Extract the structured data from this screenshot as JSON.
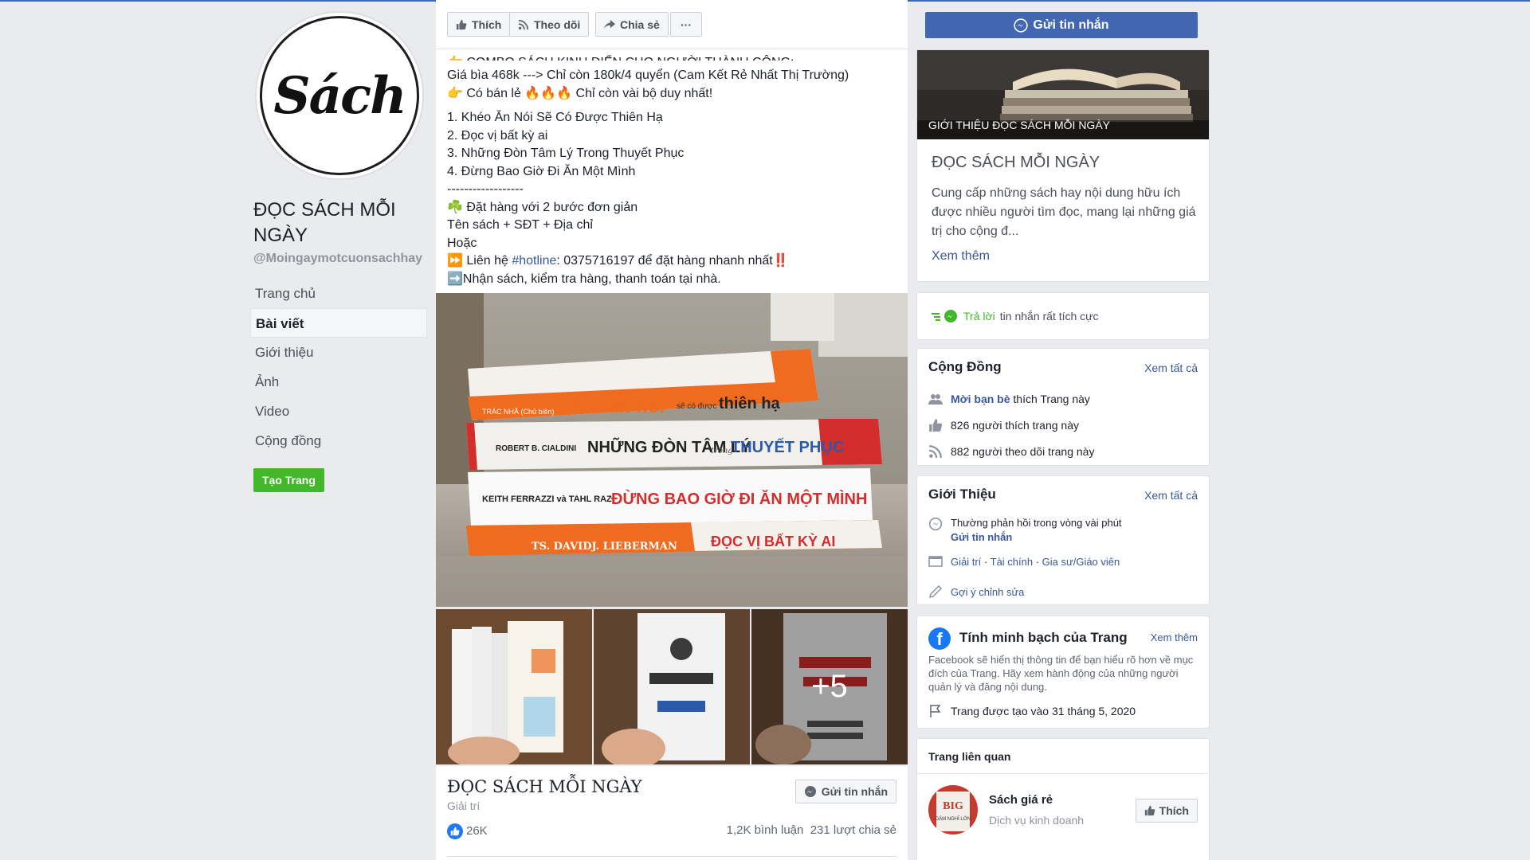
{
  "page": {
    "avatar_text": "Sách",
    "name": "ĐỌC SÁCH MỖI NGÀY",
    "handle": "@Moingaymotcuonsachhay",
    "nav": [
      "Trang chủ",
      "Bài viết",
      "Giới thiệu",
      "Ảnh",
      "Video",
      "Cộng đồng"
    ],
    "create_page": "Tạo Trang"
  },
  "actions": {
    "like": "Thích",
    "follow": "Theo dõi",
    "share": "Chia sẻ",
    "more": "···",
    "send_message": "Gửi tin nhắn"
  },
  "post": {
    "cut_line": "👉 COMBO SÁCH KINH ĐIỂN CHO NGƯỜI THÀNH CÔNG:",
    "price_line": "Giá bìa 468k ---> Chỉ còn 180k/4 quyển (Cam Kết Rẻ Nhất Thị Trường)",
    "retail_line": "👉 Có bán lẻ 🔥🔥🔥 Chỉ còn vài bộ duy nhất!",
    "books": [
      "1. Khéo Ăn Nói Sẽ Có Được Thiên Hạ",
      "2. Đọc vị bất kỳ ai",
      "3. Những Đòn Tâm Lý Trong Thuyết Phục",
      "4. Đừng Bao Giờ Đi Ăn Một Mình"
    ],
    "separator": "------------------",
    "order_line": "☘️ Đặt hàng với 2 bước đơn giản",
    "order_format": "Tên sách + SĐT + Địa chỉ",
    "or": "Hoặc",
    "contact_prefix": "⏩ Liên hệ ",
    "contact_tag": "#hotline",
    "contact_suffix": ": 0375716197 để đặt hàng nhanh nhất‼️",
    "receive_line": "➡️Nhận sách, kiểm tra hàng, thanh toán tại nhà.",
    "photo_more": "+5",
    "footer": {
      "title": "ĐỌC SÁCH MỖI NGÀY",
      "category": "Giải trí",
      "message_btn": "Gửi tin nhắn",
      "likes": "26K",
      "comments": "1,2K bình luận",
      "shares": "231 lượt chia sẻ"
    },
    "book_spines": {
      "b1_author": "TRÁC NHÃ (Chủ biên)",
      "b1_title": "Khéo ăn nói",
      "b1_sub": "sẽ có được",
      "b1_end": "thiên hạ",
      "b2_author": "ROBERT B. CIALDINI",
      "b2_title": "NHỮNG ĐÒN TÂM LÝ",
      "b2_sub": "trong",
      "b2_end": "THUYẾT PHỤC",
      "b3_author": "KEITH FERRAZZI và TAHL RAZ",
      "b3_title": "ĐỪNG BAO GIỜ ĐI ĂN MỘT MÌNH",
      "b4_author": "TS. DAVIDJ. LIEBERMAN",
      "b4_title": "ĐỌC VỊ BẤT KỲ AI"
    }
  },
  "about": {
    "img_label": "GIỚI THIỆU ĐỌC SÁCH MỖI NGÀY",
    "title": "ĐỌC SÁCH MỖI NGÀY",
    "desc": "Cung cấp những sách hay nội dung hữu ích được nhiều người tìm đọc, mang lại những giá trị cho cộng đ...",
    "more": "Xem thêm"
  },
  "response": {
    "green": "Trả lời",
    "rest": "tin nhắn rất tích cực"
  },
  "community": {
    "title": "Cộng Đồng",
    "see_all": "Xem tất cả",
    "invite_link": "Mời bạn bè",
    "invite_rest": "thích Trang này",
    "likes": "826 người thích trang này",
    "follows": "882 người theo dõi trang này"
  },
  "intro": {
    "title": "Giới Thiệu",
    "see_all": "Xem tất cả",
    "response_time": "Thường phản hồi trong vòng vài phút",
    "send_message": "Gửi tin nhắn",
    "cat1": "Giải trí",
    "cat2": "Tài chính",
    "cat3": "Gia sư/Giáo viên",
    "suggest": "Gợi ý chỉnh sửa"
  },
  "transparency": {
    "title": "Tính minh bạch của Trang",
    "see_more": "Xem thêm",
    "desc": "Facebook sẽ hiển thị thông tin để bạn hiểu rõ hơn về mục đích của Trang. Hãy xem hành động của những người quản lý và đăng nội dung.",
    "created": "Trang được tạo vào 31 tháng 5, 2020"
  },
  "related": {
    "title": "Trang liên quan",
    "name": "Sách giá rẻ",
    "category": "Dịch vụ kinh doanh",
    "like": "Thích",
    "avatar_text1": "BIG",
    "avatar_text2": "DÁM NGHĨ LỚN"
  },
  "colors": {
    "facebook_blue": "#4267b2",
    "link_blue": "#385898",
    "create_green": "#42b72a",
    "background": "#e9ebee"
  }
}
